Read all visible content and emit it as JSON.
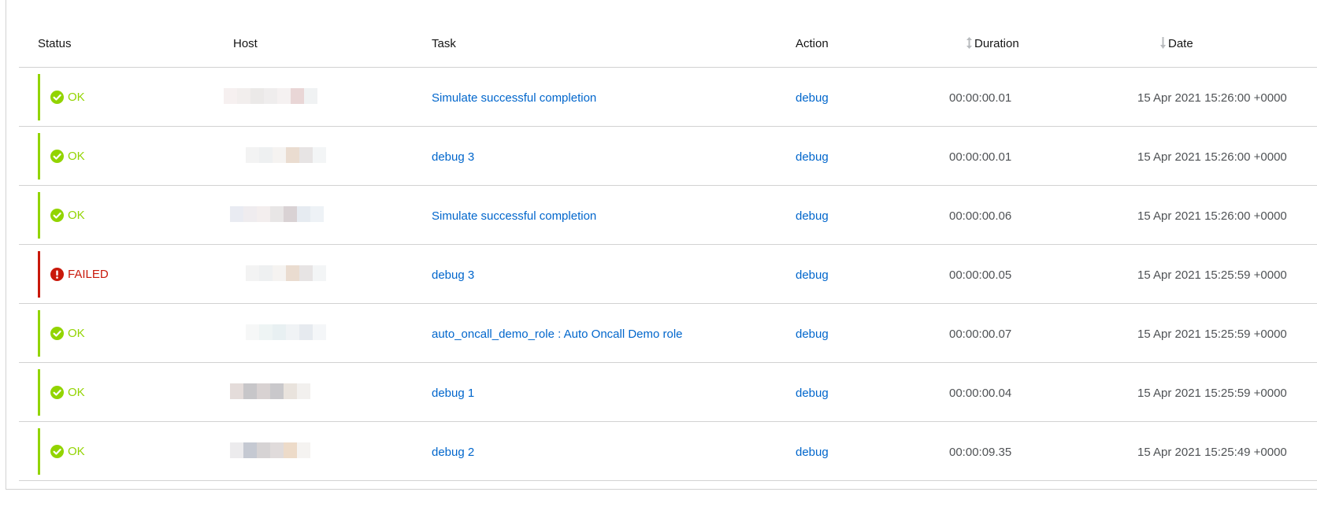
{
  "table": {
    "columns": {
      "status": "Status",
      "host": "Host",
      "task": "Task",
      "action": "Action",
      "duration": "Duration",
      "date": "Date"
    },
    "sort": {
      "duration_icon": "sort-both-icon",
      "date_icon": "sort-down-icon"
    },
    "rows": [
      {
        "status": "OK",
        "status_icon": "check-circle-icon",
        "task": "Simulate successful completion",
        "action": "debug",
        "duration": "00:00:00.01",
        "date": "15 Apr 2021 15:26:00 +0000"
      },
      {
        "status": "OK",
        "status_icon": "check-circle-icon",
        "task": "debug 3",
        "action": "debug",
        "duration": "00:00:00.01",
        "date": "15 Apr 2021 15:26:00 +0000"
      },
      {
        "status": "OK",
        "status_icon": "check-circle-icon",
        "task": "Simulate successful completion",
        "action": "debug",
        "duration": "00:00:00.06",
        "date": "15 Apr 2021 15:26:00 +0000"
      },
      {
        "status": "FAILED",
        "status_icon": "exclamation-circle-icon",
        "task": "debug 3",
        "action": "debug",
        "duration": "00:00:00.05",
        "date": "15 Apr 2021 15:25:59 +0000"
      },
      {
        "status": "OK",
        "status_icon": "check-circle-icon",
        "task": "auto_oncall_demo_role : Auto Oncall Demo role",
        "action": "debug",
        "duration": "00:00:00.07",
        "date": "15 Apr 2021 15:25:59 +0000"
      },
      {
        "status": "OK",
        "status_icon": "check-circle-icon",
        "task": "debug 1",
        "action": "debug",
        "duration": "00:00:00.04",
        "date": "15 Apr 2021 15:25:59 +0000"
      },
      {
        "status": "OK",
        "status_icon": "check-circle-icon",
        "task": "debug 2",
        "action": "debug",
        "duration": "00:00:09.35",
        "date": "15 Apr 2021 15:25:49 +0000"
      }
    ]
  },
  "colors": {
    "ok": "#92d400",
    "failed": "#c9190b",
    "link": "#0066cc",
    "border": "#d2d2d2"
  }
}
